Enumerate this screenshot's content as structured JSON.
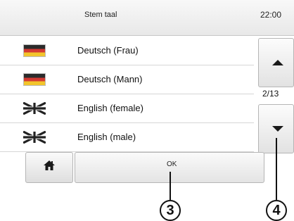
{
  "header": {
    "title": "Stem taal",
    "time": "22:00"
  },
  "voices": [
    {
      "label": "Deutsch (Frau)",
      "flag": "german-flag-icon"
    },
    {
      "label": "Deutsch (Mann)",
      "flag": "german-flag-icon"
    },
    {
      "label": "English (female)",
      "flag": "uk-flag-icon"
    },
    {
      "label": "English (male)",
      "flag": "uk-flag-icon"
    }
  ],
  "pagination": {
    "indicator": "2/13"
  },
  "footer": {
    "ok_label": "OK"
  },
  "callouts": {
    "ok": "3",
    "scroll": "4"
  }
}
